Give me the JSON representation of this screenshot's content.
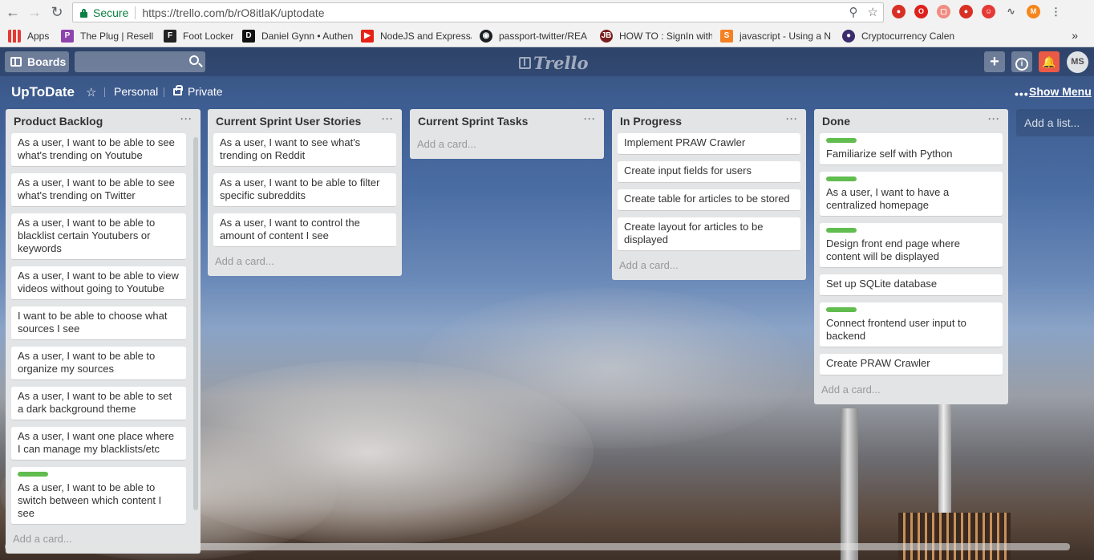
{
  "browser": {
    "secure_label": "Secure",
    "url": "https://trello.com/b/rO8itlaK/uptodate",
    "bookmarks": [
      {
        "label": "Apps",
        "icon": "apps-grid-icon",
        "color": "#ffffff"
      },
      {
        "label": "The Plug | Resell Cart",
        "icon": "the-plug-icon",
        "color": "#8e44ad"
      },
      {
        "label": "Foot Locker",
        "icon": "foot-locker-icon",
        "color": "#222222"
      },
      {
        "label": "Daniel Gynn • Authen",
        "icon": "letter-d-icon",
        "color": "#111111"
      },
      {
        "label": "NodeJS and ExpressJS",
        "icon": "youtube-icon",
        "color": "#e62117"
      },
      {
        "label": "passport-twitter/REA",
        "icon": "github-icon",
        "color": "#1b1f23"
      },
      {
        "label": "HOW TO : SignIn with",
        "icon": "jb-logo-icon",
        "color": "#7a1f1f"
      },
      {
        "label": "javascript - Using a N",
        "icon": "stackoverflow-icon",
        "color": "#f48024"
      },
      {
        "label": "Cryptocurrency Calen",
        "icon": "crypto-globe-icon",
        "color": "#3b2d6b"
      }
    ]
  },
  "header": {
    "boards_label": "Boards",
    "logo_text": "Trello",
    "avatar_initials": "MS",
    "add_label": "+",
    "info_label": "i",
    "notification_color": "#eb5a46"
  },
  "board": {
    "title": "UpToDate",
    "team": "Personal",
    "visibility": "Private",
    "dots": "•••",
    "show_menu": "Show Menu",
    "add_list": "Add a list..."
  },
  "lists": [
    {
      "title": "Product Backlog",
      "cards": [
        {
          "text": "As a user, I want to be able to see what's trending on Youtube",
          "label": false
        },
        {
          "text": "As a user, I want to be able to see what's trending on Twitter",
          "label": false
        },
        {
          "text": "As a user, I want to be able to blacklist certain Youtubers or keywords",
          "label": false
        },
        {
          "text": "As a user, I want to be able to view videos without going to Youtube",
          "label": false
        },
        {
          "text": "I want to be able to choose what sources I see",
          "label": false
        },
        {
          "text": "As a user, I want to be able to organize my sources",
          "label": false
        },
        {
          "text": "As a user, I want to be able to set a dark background theme",
          "label": false
        },
        {
          "text": "As a user, I want one place where I can manage my blacklists/etc",
          "label": false
        },
        {
          "text": "As a user, I want to be able to switch between which content I see",
          "label": true
        }
      ],
      "add_card": "Add a card..."
    },
    {
      "title": "Current Sprint User Stories",
      "cards": [
        {
          "text": "As a user, I want to see what's trending on Reddit",
          "label": false
        },
        {
          "text": "As a user, I want to be able to filter specific subreddits",
          "label": false
        },
        {
          "text": "As a user, I want to control the amount of content I see",
          "label": false
        }
      ],
      "add_card": "Add a card..."
    },
    {
      "title": "Current Sprint Tasks",
      "cards": [],
      "add_card": "Add a card..."
    },
    {
      "title": "In Progress",
      "cards": [
        {
          "text": "Implement PRAW Crawler",
          "label": false
        },
        {
          "text": "Create input fields for users",
          "label": false
        },
        {
          "text": "Create table for articles to be stored",
          "label": false
        },
        {
          "text": "Create layout for articles to be displayed",
          "label": false
        }
      ],
      "add_card": "Add a card..."
    },
    {
      "title": "Done",
      "cards": [
        {
          "text": "Familiarize self with Python",
          "label": true
        },
        {
          "text": "As a user, I want to have a centralized homepage",
          "label": true
        },
        {
          "text": "Design front end page where content will be displayed",
          "label": true
        },
        {
          "text": "Set up SQLite database",
          "label": false
        },
        {
          "text": "Connect frontend user input to backend",
          "label": true
        },
        {
          "text": "Create PRAW Crawler",
          "label": false
        }
      ],
      "add_card": "Add a card..."
    }
  ],
  "label_color": "#61bd4f"
}
